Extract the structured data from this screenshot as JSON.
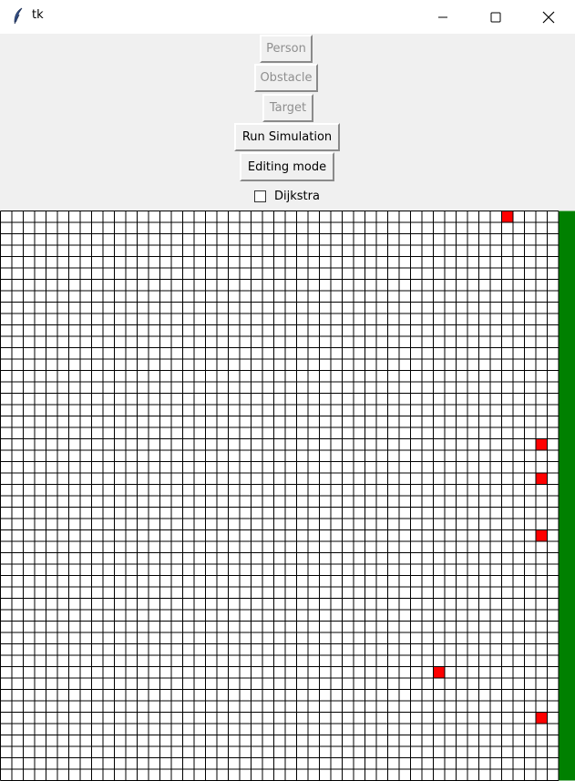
{
  "window": {
    "title": "tk",
    "app_icon": "feather-icon",
    "controls": [
      "minimize-icon",
      "maximize-icon",
      "close-icon"
    ]
  },
  "toolbar": {
    "person_label": "Person",
    "obstacle_label": "Obstacle",
    "target_label": "Target",
    "run_simulation_label": "Run Simulation",
    "editing_mode_label": "Editing mode",
    "dijkstra_label": "Dijkstra",
    "dijkstra_checked": false
  },
  "grid": {
    "columns": 49,
    "rows": 50,
    "cell_color": "#ffffff",
    "line_color": "#000000",
    "persons": [
      {
        "col": 44,
        "row": 0
      },
      {
        "col": 47,
        "row": 20
      },
      {
        "col": 47,
        "row": 23
      },
      {
        "col": 47,
        "row": 28
      },
      {
        "col": 38,
        "row": 40
      },
      {
        "col": 47,
        "row": 44
      }
    ],
    "person_color": "#ff0000",
    "target_column": 49,
    "target_color": "#008000"
  }
}
